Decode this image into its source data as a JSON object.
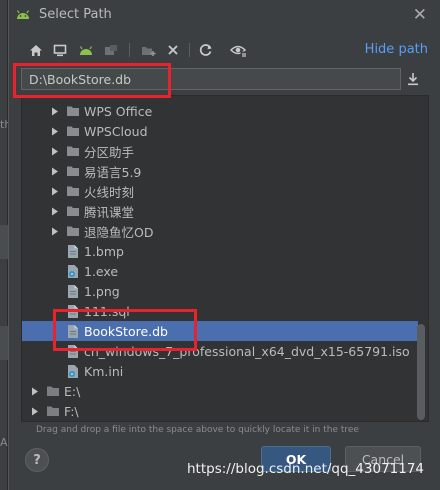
{
  "window": {
    "title": "Select Path"
  },
  "background_fragments": [
    "th",
    "A"
  ],
  "toolbar": {
    "icons": [
      "home-icon",
      "desktop-icon",
      "android-icon",
      "module-icon",
      "new-folder-icon",
      "delete-icon",
      "refresh-icon",
      "show-hidden-icon"
    ],
    "hide_path_label": "Hide path"
  },
  "path": {
    "value": "D:\\BookStore.db"
  },
  "tree": {
    "rows": [
      {
        "label": "WPS Office",
        "type": "folder",
        "expandable": true
      },
      {
        "label": "WPSCloud",
        "type": "folder",
        "expandable": true
      },
      {
        "label": "分区助手",
        "type": "folder",
        "expandable": true
      },
      {
        "label": "易语言5.9",
        "type": "folder",
        "expandable": true
      },
      {
        "label": "火线时刻",
        "type": "folder",
        "expandable": true
      },
      {
        "label": "腾讯课堂",
        "type": "folder",
        "expandable": true
      },
      {
        "label": "退隐鱼忆OD",
        "type": "folder",
        "expandable": true
      },
      {
        "label": "1.bmp",
        "type": "file"
      },
      {
        "label": "1.exe",
        "type": "exe"
      },
      {
        "label": "1.png",
        "type": "file"
      },
      {
        "label": "111.sql",
        "type": "file"
      },
      {
        "label": "BookStore.db",
        "type": "file",
        "selected": true
      },
      {
        "label": "cn_windows_7_professional_x64_dvd_x15-65791.iso",
        "type": "file"
      },
      {
        "label": "Km.ini",
        "type": "exe"
      },
      {
        "label": "E:\\",
        "type": "drive",
        "expandable": true
      },
      {
        "label": "F:\\",
        "type": "drive",
        "expandable": true
      }
    ]
  },
  "hint": "Drag and drop a file into the space above to quickly locate it in the tree",
  "buttons": {
    "help": "?",
    "ok": "OK",
    "cancel": "Cancel"
  },
  "watermark": "https://blog.csdn.net/qq_43071174",
  "colors": {
    "selection": "#4b6eaf",
    "link": "#589df6",
    "highlight_box": "#e8232e",
    "ok_button": "#365880"
  }
}
